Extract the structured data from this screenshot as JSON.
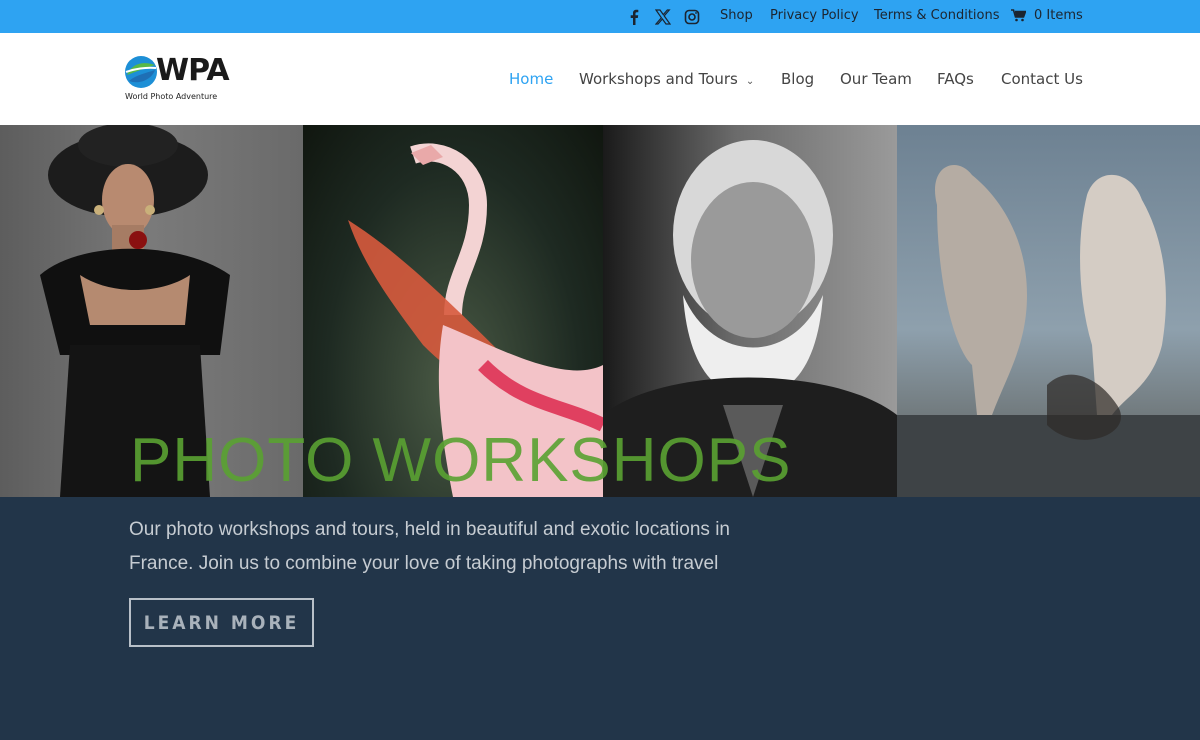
{
  "colors": {
    "topbar": "#2ea3f2",
    "accent": "#2ea3f2",
    "hero_title": "#5aa232",
    "footer_bg": "#223549"
  },
  "topbar": {
    "social": [
      "facebook-icon",
      "x-icon",
      "instagram-icon"
    ],
    "links": [
      "Shop",
      "Privacy Policy",
      "Terms & Conditions"
    ],
    "cart_label": "0 Items"
  },
  "header": {
    "logo_text": "WPA",
    "logo_sub": "World Photo Adventure",
    "nav": [
      {
        "label": "Home",
        "active": true
      },
      {
        "label": "Workshops and Tours",
        "has_dropdown": true
      },
      {
        "label": "Blog"
      },
      {
        "label": "Our Team"
      },
      {
        "label": "FAQs"
      },
      {
        "label": "Contact Us"
      }
    ]
  },
  "hero": {
    "title": "PHOTO WORKSHOPS",
    "text_line1": "Our photo workshops and tours, held in beautiful and exotic locations in",
    "text_line2": "France. Join us to combine your love of taking photographs with travel",
    "button": "LEARN MORE"
  }
}
